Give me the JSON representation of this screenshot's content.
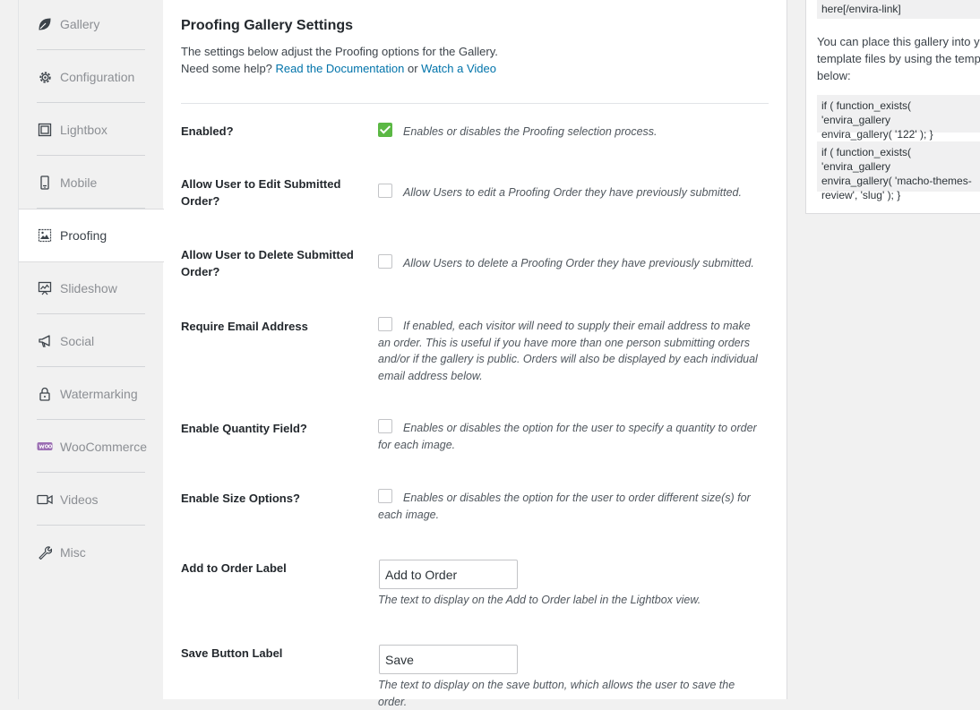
{
  "sidebar": {
    "items": [
      {
        "label": "Gallery",
        "icon": "leaf-icon"
      },
      {
        "label": "Configuration",
        "icon": "gear-icon"
      },
      {
        "label": "Lightbox",
        "icon": "lightbox-icon"
      },
      {
        "label": "Mobile",
        "icon": "mobile-icon"
      },
      {
        "label": "Proofing",
        "icon": "proofing-icon",
        "active": true
      },
      {
        "label": "Slideshow",
        "icon": "slideshow-icon"
      },
      {
        "label": "Social",
        "icon": "megaphone-icon"
      },
      {
        "label": "Watermarking",
        "icon": "lock-icon"
      },
      {
        "label": "WooCommerce",
        "icon": "woocommerce-icon"
      },
      {
        "label": "Videos",
        "icon": "video-icon"
      },
      {
        "label": "Misc",
        "icon": "wrench-icon"
      }
    ]
  },
  "main": {
    "title": "Proofing Gallery Settings",
    "desc_line1": "The settings below adjust the Proofing options for the Gallery.",
    "desc_help": "Need some help?",
    "doc_link": "Read the Documentation",
    "or": "or",
    "video_link": "Watch a Video",
    "settings": {
      "enabled": {
        "label": "Enabled?",
        "checked": true,
        "desc": "Enables or disables the Proofing selection process."
      },
      "edit": {
        "label": "Allow User to Edit Submitted Order?",
        "checked": false,
        "desc": "Allow Users to edit a Proofing Order they have previously submitted."
      },
      "delete": {
        "label": "Allow User to Delete Submitted Order?",
        "checked": false,
        "desc": "Allow Users to delete a Proofing Order they have previously submitted."
      },
      "email": {
        "label": "Require Email Address",
        "checked": false,
        "desc": "If enabled, each visitor will need to supply their email address to make an order. This is useful if you have more than one person submitting orders and/or if the gallery is public. Orders will also be displayed by each individual email address below."
      },
      "quantity": {
        "label": "Enable Quantity Field?",
        "checked": false,
        "desc": "Enables or disables the option for the user to specify a quantity to order for each image."
      },
      "size": {
        "label": "Enable Size Options?",
        "checked": false,
        "desc": "Enables or disables the option for the user to order different size(s) for each image."
      },
      "add_label": {
        "label": "Add to Order Label",
        "value": "Add to Order",
        "help": "The text to display on the Add to Order label in the Lightbox view."
      },
      "save_label": {
        "label": "Save Button Label",
        "value": "Save",
        "help": "The text to display on the save button, which allows the user to save the order."
      }
    }
  },
  "right": {
    "code_top": "here[/envira-link]",
    "text1": "You can place this gallery into yo",
    "text2": "template files by using the temp",
    "text3": "below:",
    "code1": "if ( function_exists( 'envira_gallery\nenvira_gallery( '122' ); }",
    "code2": "if ( function_exists( 'envira_gallery\nenvira_gallery( 'macho-themes-\nreview', 'slug' ); }"
  },
  "colors": {
    "accent": "#0073aa",
    "check": "#5bb844"
  }
}
